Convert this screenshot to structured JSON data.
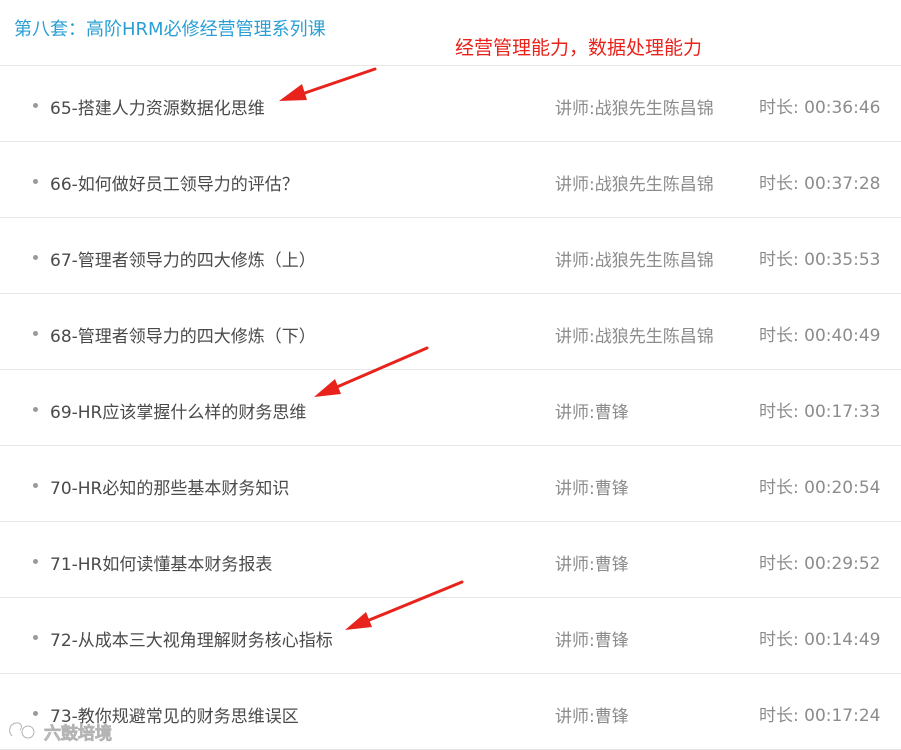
{
  "header": {
    "series_title": "第八套：高阶HRM必修经营管理系列课",
    "annotation": "经营管理能力，数据处理能力",
    "annotation_color": "#e8231c",
    "accent_color": "#2a9fd6"
  },
  "courses": [
    {
      "title": "65-搭建人力资源数据化思维",
      "lecturer": "讲师:战狼先生陈昌锦",
      "duration": "时长: 00:36:46"
    },
    {
      "title": "66-如何做好员工领导力的评估？",
      "lecturer": "讲师:战狼先生陈昌锦",
      "duration": "时长: 00:37:28"
    },
    {
      "title": "67-管理者领导力的四大修炼（上）",
      "lecturer": "讲师:战狼先生陈昌锦",
      "duration": "时长: 00:35:53"
    },
    {
      "title": "68-管理者领导力的四大修炼（下）",
      "lecturer": "讲师:战狼先生陈昌锦",
      "duration": "时长: 00:40:49"
    },
    {
      "title": "69-HR应该掌握什么样的财务思维",
      "lecturer": "讲师:曹锋",
      "duration": "时长: 00:17:33"
    },
    {
      "title": "70-HR必知的那些基本财务知识",
      "lecturer": "讲师:曹锋",
      "duration": "时长: 00:20:54"
    },
    {
      "title": "71-HR如何读懂基本财务报表",
      "lecturer": "讲师:曹锋",
      "duration": "时长: 00:29:52"
    },
    {
      "title": "72-从成本三大视角理解财务核心指标",
      "lecturer": "讲师:曹锋",
      "duration": "时长: 00:14:49"
    },
    {
      "title": "73-教你规避常见的财务思维误区",
      "lecturer": "讲师:曹锋",
      "duration": "时长: 00:17:24"
    }
  ],
  "annotation_arrows": {
    "icon": "red-arrow-icon",
    "points_to_courses": [
      "65",
      "69",
      "72"
    ]
  },
  "watermark": {
    "text": "六鼓培境",
    "icon": "watermark-logo-icon"
  }
}
